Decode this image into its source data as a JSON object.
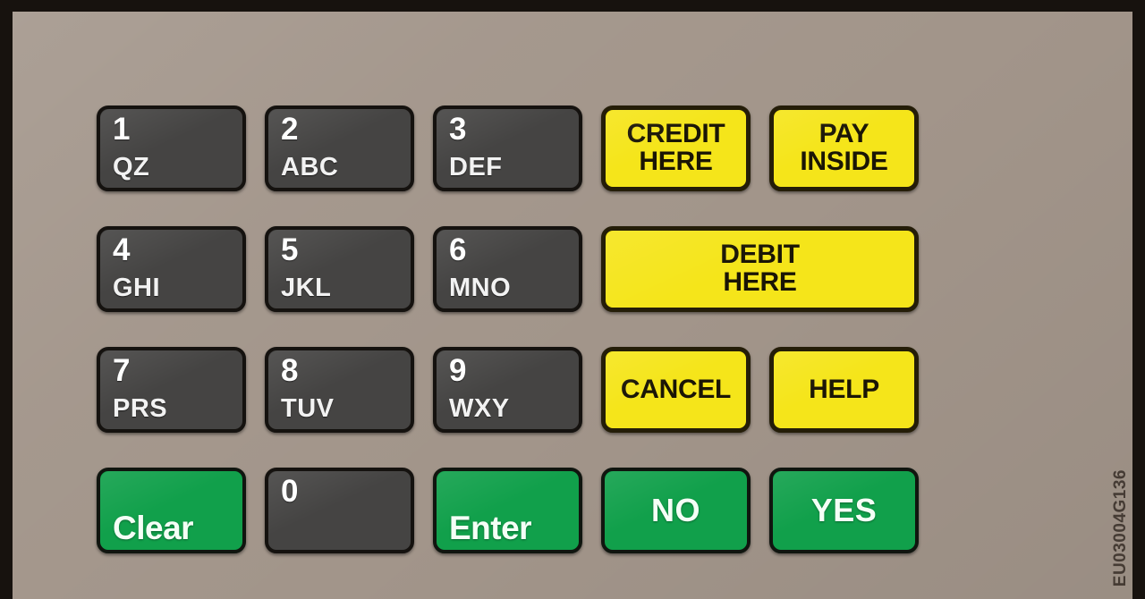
{
  "panel": {
    "name": "fuel-dispenser-keypad-overlay",
    "face_color": "#a2958a",
    "bezel_color": "#17120e",
    "part_number": "EU03004G136"
  },
  "palette": {
    "numeric_key_fill": "#454443",
    "numeric_key_border": "#15120f",
    "numeric_key_text": "#ffffff",
    "yellow_key_fill": "#f5e51a",
    "yellow_key_border": "#241d08",
    "yellow_key_text": "#1a1505",
    "green_key_fill": "#11a04b",
    "green_key_border": "#10150f",
    "green_key_text": "#f4fff6"
  },
  "keys": [
    {
      "digit": "1",
      "letters": "QZ",
      "type": "numeric"
    },
    {
      "digit": "2",
      "letters": "ABC",
      "type": "numeric"
    },
    {
      "digit": "3",
      "letters": "DEF",
      "type": "numeric"
    },
    {
      "label": "CREDIT\nHERE",
      "type": "yellow"
    },
    {
      "label": "PAY\nINSIDE",
      "type": "yellow"
    },
    {
      "digit": "4",
      "letters": "GHI",
      "type": "numeric"
    },
    {
      "digit": "5",
      "letters": "JKL",
      "type": "numeric"
    },
    {
      "digit": "6",
      "letters": "MNO",
      "type": "numeric"
    },
    {
      "label": "DEBIT\nHERE",
      "type": "yellow-wide"
    },
    {
      "digit": "7",
      "letters": "PRS",
      "type": "numeric"
    },
    {
      "digit": "8",
      "letters": "TUV",
      "type": "numeric"
    },
    {
      "digit": "9",
      "letters": "WXY",
      "type": "numeric"
    },
    {
      "label": "CANCEL",
      "type": "yellow"
    },
    {
      "label": "HELP",
      "type": "yellow"
    },
    {
      "label": "Clear",
      "type": "green-bottom-left"
    },
    {
      "digit": "0",
      "letters": "",
      "type": "numeric-zero"
    },
    {
      "label": "Enter",
      "type": "green-bottom-left"
    },
    {
      "label": "NO",
      "type": "green-center"
    },
    {
      "label": "YES",
      "type": "green-center"
    }
  ]
}
